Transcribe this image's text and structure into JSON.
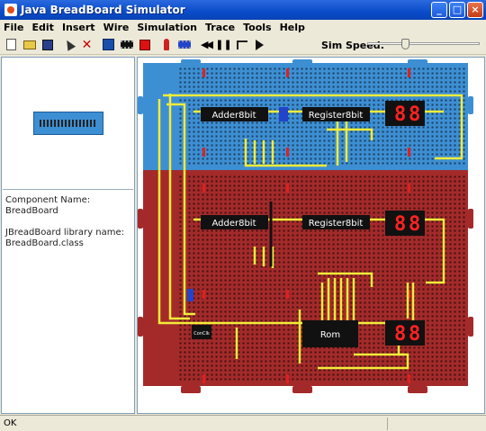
{
  "window": {
    "title": "Java BreadBoard Simulator",
    "buttons": {
      "minimize": "_",
      "maximize": "□",
      "close": "×"
    }
  },
  "menu": {
    "items": [
      "File",
      "Edit",
      "Insert",
      "Wire",
      "Simulation",
      "Trace",
      "Tools",
      "Help"
    ]
  },
  "toolbar": {
    "icons": [
      "new-icon",
      "open-icon",
      "save-icon",
      "select-arrow-icon",
      "delete-icon",
      "breadboard-icon",
      "chip-icon",
      "red-component-icon",
      "led-icon",
      "ic-icon",
      "rewind-icon",
      "pause-icon",
      "step-icon",
      "play-icon"
    ],
    "speed_label": "Sim Speed:",
    "speed_level": 0.33
  },
  "left_panel": {
    "component_name_label": "Component Name:",
    "component_name_value": "BreadBoard",
    "library_label": "JBreadBoard library name:",
    "library_value": "BreadBoard.class"
  },
  "board": {
    "chips": {
      "top_adder": "Adder8bit",
      "top_register": "Register8bit",
      "mid_adder": "Adder8bit",
      "mid_register": "Register8bit",
      "clock": "ConClk",
      "rom": "Rom"
    },
    "colors": {
      "blue_board": "#3d8fd3",
      "red_board": "#a42a2a",
      "wire": "#f2ec3a",
      "seg": "#ff2222"
    }
  },
  "status": {
    "text": "OK"
  }
}
